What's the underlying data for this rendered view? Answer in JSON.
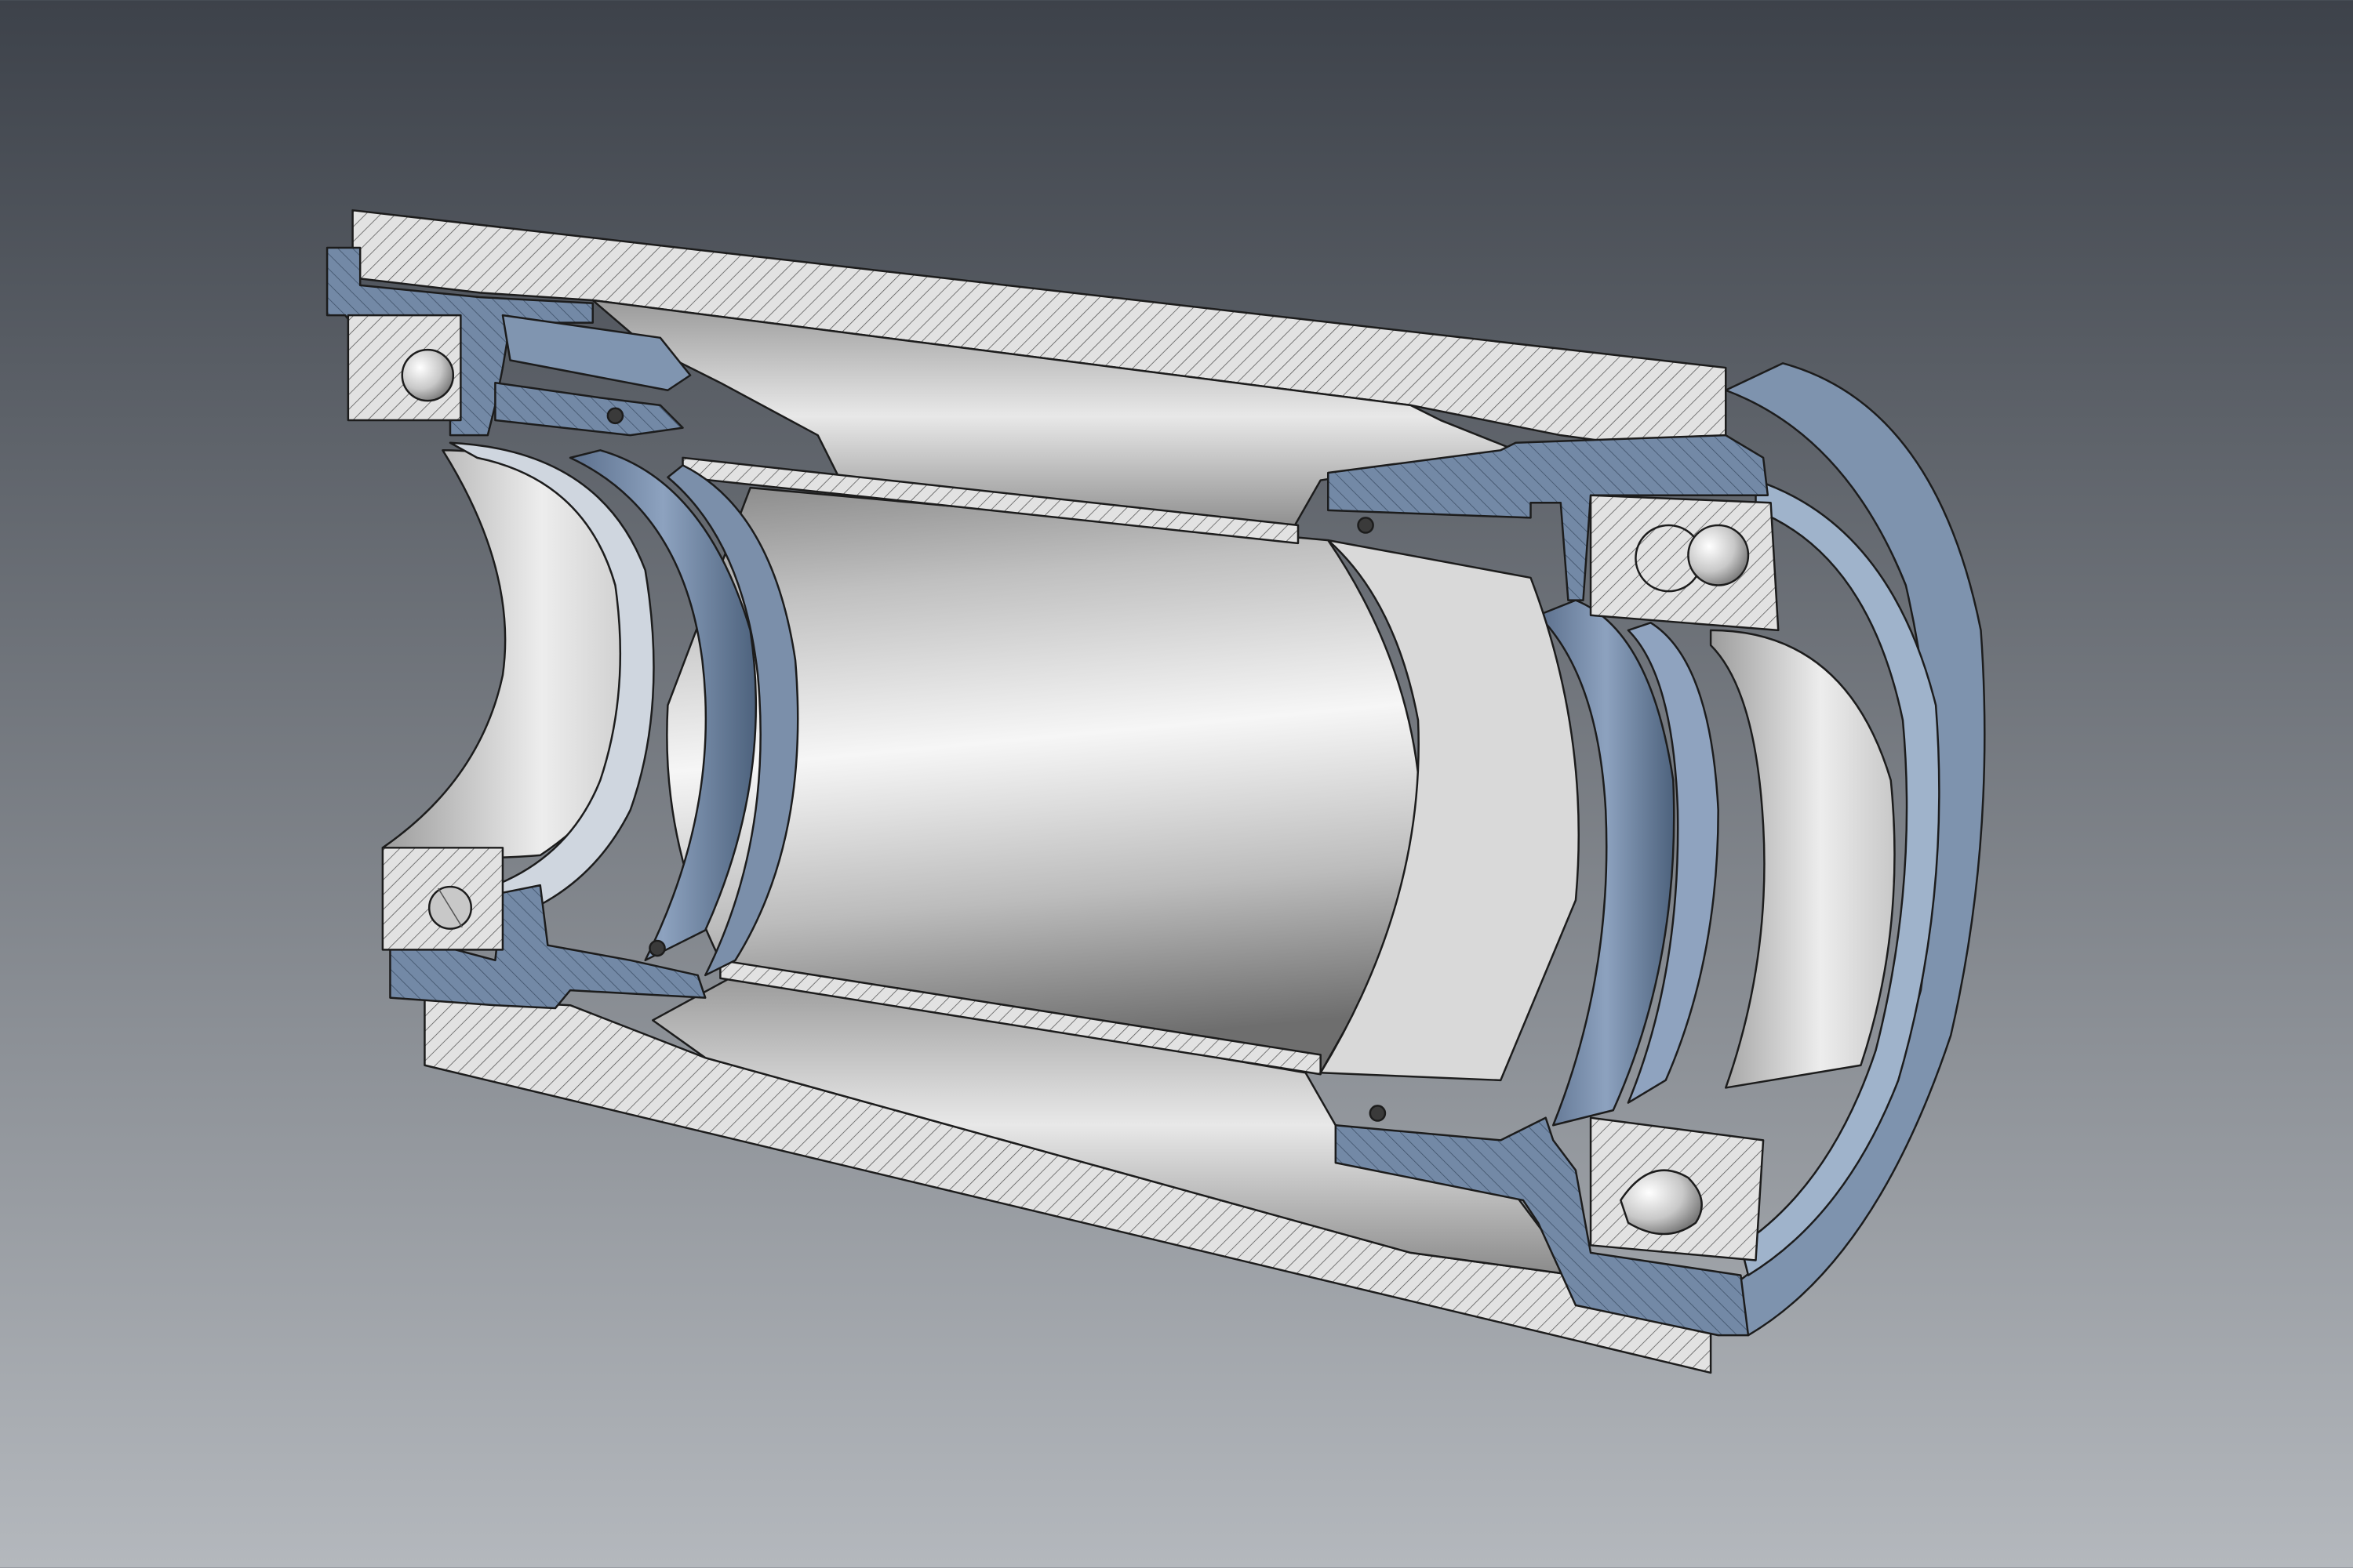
{
  "viewer": {
    "model": "bearing-housing-assembly-section-view",
    "view_mode": "section-cut",
    "background_top_color": "#3d424a",
    "background_bottom_color": "#b4b8bd"
  },
  "colors": {
    "steel_light": "#f2f2f2",
    "steel_mid": "#c4c4c4",
    "steel_dark": "#8c8c8c",
    "section_gray": "#e2e2e2",
    "section_blue": "#7389a6",
    "blue_light": "#9fb3cb",
    "blue_dark": "#4d627d",
    "outline": "#1c1c1c",
    "hatch_line": "#555555"
  },
  "parts": [
    {
      "id": "outer-housing",
      "material": "steel",
      "section_fill": "gray"
    },
    {
      "id": "left-flange-cap",
      "material": "anodized",
      "section_fill": "blue"
    },
    {
      "id": "right-flange-cap",
      "material": "anodized",
      "section_fill": "blue"
    },
    {
      "id": "left-ball-bearing",
      "material": "steel",
      "section_fill": "gray"
    },
    {
      "id": "right-ball-bearing",
      "material": "steel",
      "section_fill": "gray"
    },
    {
      "id": "inner-sleeve",
      "material": "steel",
      "section_fill": "gray"
    },
    {
      "id": "left-seal-ring",
      "material": "anodized",
      "section_fill": "blue"
    },
    {
      "id": "right-seal-ring",
      "material": "anodized",
      "section_fill": "blue"
    },
    {
      "id": "o-ring-seals",
      "material": "rubber",
      "section_fill": "dark"
    },
    {
      "id": "end-cover-ring",
      "material": "anodized",
      "section_fill": "blue"
    }
  ]
}
